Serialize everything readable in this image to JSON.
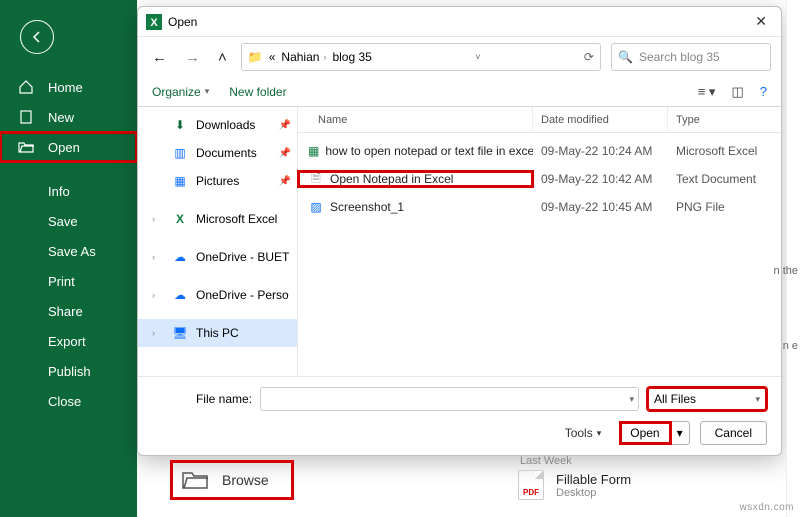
{
  "sidebar": {
    "items": [
      {
        "icon": "home-icon",
        "label": "Home"
      },
      {
        "icon": "new-icon",
        "label": "New"
      },
      {
        "icon": "open-icon",
        "label": "Open",
        "highlight": true
      },
      {
        "icon": "",
        "label": "Info"
      },
      {
        "icon": "",
        "label": "Save"
      },
      {
        "icon": "",
        "label": "Save As"
      },
      {
        "icon": "",
        "label": "Print"
      },
      {
        "icon": "",
        "label": "Share"
      },
      {
        "icon": "",
        "label": "Export"
      },
      {
        "icon": "",
        "label": "Publish"
      },
      {
        "icon": "",
        "label": "Close"
      }
    ]
  },
  "dialog": {
    "title": "Open",
    "breadcrumbs": [
      "Nahian",
      "blog 35"
    ],
    "search_placeholder": "Search blog 35",
    "toolbar": {
      "organize": "Organize",
      "new_folder": "New folder"
    },
    "tree": [
      {
        "icon": "↓",
        "label": "Downloads",
        "pinned": true,
        "color": "#0d6839"
      },
      {
        "icon": "▥",
        "label": "Documents",
        "pinned": true,
        "color": "#0d6efd"
      },
      {
        "icon": "▦",
        "label": "Pictures",
        "pinned": true,
        "color": "#0d6efd"
      },
      {
        "exp": "›",
        "icon": "X",
        "label": "Microsoft Excel",
        "color": "#107c41"
      },
      {
        "exp": "›",
        "icon": "☁",
        "label": "OneDrive - BUET",
        "color": "#0d6efd"
      },
      {
        "exp": "›",
        "icon": "☁",
        "label": "OneDrive - Perso",
        "color": "#0d6efd"
      },
      {
        "exp": "›",
        "icon": "🖥",
        "label": "This PC",
        "selected": true,
        "color": "#0d6efd"
      }
    ],
    "columns": {
      "name": "Name",
      "date": "Date modified",
      "type": "Type"
    },
    "files": [
      {
        "icon": "excel",
        "name": "how to open notepad or text file in excel ...",
        "date": "09-May-22 10:24 AM",
        "type": "Microsoft Excel"
      },
      {
        "icon": "text",
        "name": "Open Notepad in Excel",
        "date": "09-May-22 10:42 AM",
        "type": "Text Document",
        "highlight": true
      },
      {
        "icon": "image",
        "name": "Screenshot_1",
        "date": "09-May-22 10:45 AM",
        "type": "PNG File"
      }
    ],
    "footer": {
      "file_name_label": "File name:",
      "file_name_value": "",
      "filter": "All Files",
      "tools": "Tools",
      "open": "Open",
      "cancel": "Cancel"
    }
  },
  "backstage": {
    "browse": "Browse",
    "last_week": "Last Week",
    "recent": {
      "title": "Fillable Form",
      "path": "Desktop",
      "badge": "PDF"
    }
  },
  "right_edge": {
    "hint_1": "n the",
    "hint_2": "n e"
  },
  "watermark": "wsxdn.com"
}
